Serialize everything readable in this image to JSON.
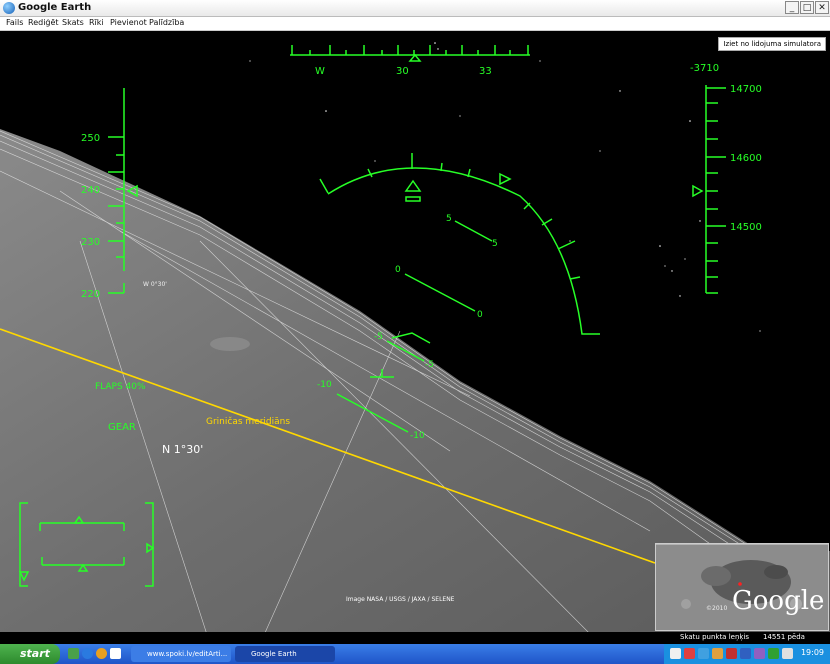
{
  "window": {
    "title": "Google Earth"
  },
  "menu": [
    "Fails",
    "Rediģēt",
    "Skats",
    "Rīki",
    "Pievienot",
    "Palīdzība"
  ],
  "exit_button": "Iziet no lidojuma simulatora",
  "compass": {
    "labels": [
      "W",
      "30",
      "33"
    ]
  },
  "vertical_speed": "-3710",
  "speed_scale": [
    "250",
    "240",
    "230",
    "220"
  ],
  "altitude_scale": [
    "14700",
    "14600",
    "14500"
  ],
  "pitch_labels": {
    "p5_left": "5",
    "p5_right": "5",
    "p0_left": "0",
    "p0_right": "0",
    "m5_left": "-5",
    "m5_right": "-5",
    "m10_left": "-10",
    "m10_right": "-10"
  },
  "flaps": "FLAPS 40%",
  "gear": "GEAR",
  "small_label": "W 0°30'",
  "map_labels": {
    "meridian": "Griničas meridiāns",
    "latitude": "N 1°30'"
  },
  "imagery_credit": "Image NASA / USGS / JAXA / SELENE",
  "minimap": {
    "copyright": "©2010",
    "logo": "Google"
  },
  "status": {
    "view_angle": "Skatu punkta leņķis",
    "altitude": "14551 pēda"
  },
  "taskbar": {
    "start": "start",
    "tasks": [
      "www.spoki.lv/editArti...",
      "Google Earth"
    ],
    "clock": "19:09"
  },
  "colors": {
    "hud": "#27ff27",
    "meridian": "#ffd800",
    "taskbar": "#245edb",
    "start": "#3c9b3c"
  }
}
